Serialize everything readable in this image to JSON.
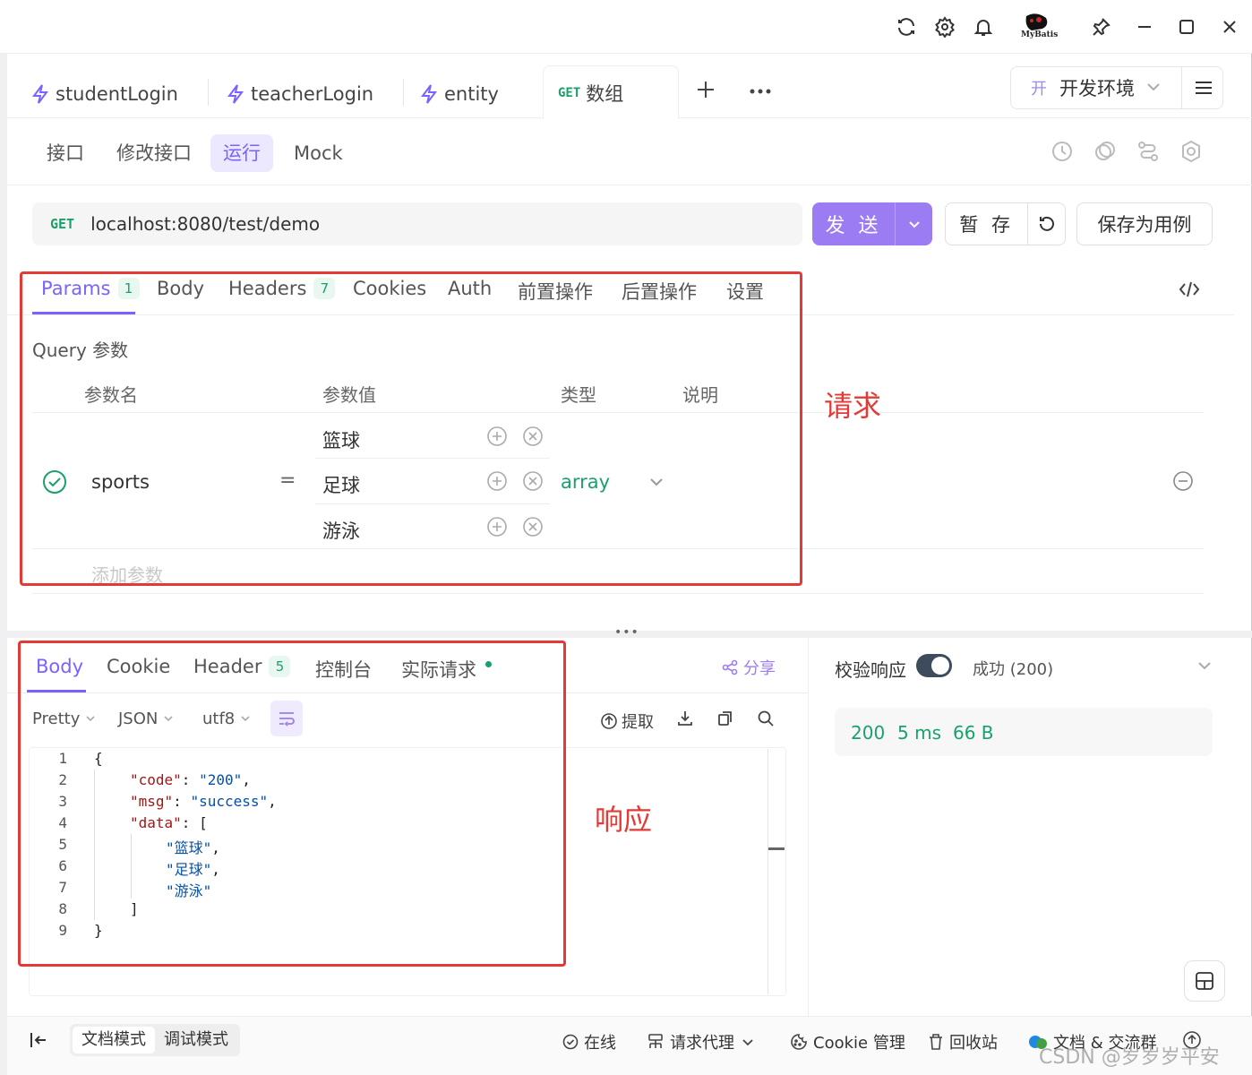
{
  "titlebar": {
    "icons": [
      "refresh-icon",
      "gear-icon",
      "bell-icon",
      "mybatis-logo",
      "pin-icon",
      "minimize-icon",
      "maximize-icon",
      "close-icon"
    ],
    "logo_text": "MyBatis"
  },
  "tabs": [
    {
      "label": "studentLogin",
      "icon": "bolt-icon"
    },
    {
      "label": "teacherLogin",
      "icon": "bolt-icon"
    },
    {
      "label": "entity",
      "icon": "bolt-icon"
    },
    {
      "label": "数组",
      "method": "GET",
      "active": true
    }
  ],
  "environment": {
    "badge": "开",
    "label": "开发环境"
  },
  "subnav": [
    "接口",
    "修改接口",
    "运行",
    "Mock"
  ],
  "subnav_active": "运行",
  "url": {
    "method": "GET",
    "value": "localhost:8080/test/demo"
  },
  "actions": {
    "send": "发 送",
    "stash": "暂 存",
    "save_as": "保存为用例"
  },
  "request_tabs": [
    {
      "label": "Params",
      "count": "1"
    },
    {
      "label": "Body"
    },
    {
      "label": "Headers",
      "count": "7"
    },
    {
      "label": "Cookies"
    },
    {
      "label": "Auth"
    },
    {
      "label": "前置操作"
    },
    {
      "label": "后置操作"
    },
    {
      "label": "设置"
    }
  ],
  "query": {
    "title": "Query 参数",
    "columns": [
      "参数名",
      "参数值",
      "类型",
      "说明"
    ],
    "param": {
      "name": "sports",
      "equals": "=",
      "values": [
        "篮球",
        "足球",
        "游泳"
      ],
      "type": "array"
    },
    "add_placeholder": "添加参数"
  },
  "annotations": {
    "request": "请求",
    "response": "响应",
    "box_color": "#e53935"
  },
  "response_tabs": [
    {
      "label": "Body"
    },
    {
      "label": "Cookie"
    },
    {
      "label": "Header",
      "count": "5"
    },
    {
      "label": "控制台"
    },
    {
      "label": "实际请求"
    }
  ],
  "share": "分享",
  "response_toolbar": {
    "format": "Pretty",
    "lang": "JSON",
    "encoding": "utf8",
    "extract": "提取"
  },
  "code_lines": [
    {
      "n": "1"
    },
    {
      "n": "2"
    },
    {
      "n": "3"
    },
    {
      "n": "4"
    },
    {
      "n": "5"
    },
    {
      "n": "6"
    },
    {
      "n": "7"
    },
    {
      "n": "8"
    },
    {
      "n": "9"
    }
  ],
  "code": {
    "open": "{",
    "code_key": "\"code\"",
    "code_val": "\"200\"",
    "msg_key": "\"msg\"",
    "msg_val": "\"success\"",
    "data_key": "\"data\"",
    "item1": "\"篮球\"",
    "item2": "\"足球\"",
    "item3": "\"游泳\"",
    "close_arr": "]",
    "close": "}"
  },
  "verify": {
    "label": "校验响应",
    "status": "成功 (200)",
    "enabled": true
  },
  "stats": {
    "status": "200",
    "time": "5 ms",
    "size": "66 B"
  },
  "statusbar": {
    "modes": [
      "文档模式",
      "调试模式"
    ],
    "active_mode": "文档模式",
    "online": "在线",
    "proxy": "请求代理",
    "cookie": "Cookie 管理",
    "trash": "回收站",
    "docs": "文档 & 交流群"
  },
  "watermark": "CSDN @岁岁岁平安",
  "colors": {
    "accent": "#7b61ff",
    "green": "#1aa16a",
    "red": "#e53935"
  }
}
